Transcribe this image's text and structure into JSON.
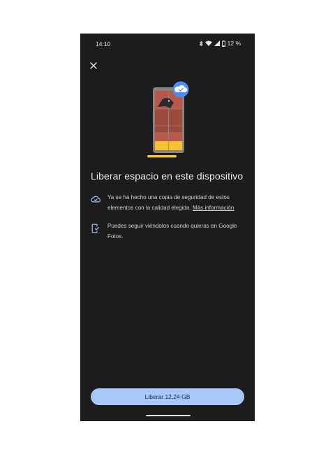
{
  "status_bar": {
    "time": "14:10",
    "battery_percent": "12 %",
    "icons": [
      "bluetooth-icon",
      "wifi-icon",
      "signal-icon",
      "battery-icon"
    ]
  },
  "close_icon": "close-icon",
  "title": "Liberar espacio en este dispositivo",
  "info_items": [
    {
      "icon": "cloud-done-icon",
      "text": "Ya se ha hecho una copia de seguridad de estos elementos con la calidad elegida.",
      "link": "Más información"
    },
    {
      "icon": "phone-check-icon",
      "text": "Puedes seguir viéndolos cuando quieras en Google Fotos."
    }
  ],
  "primary_button": {
    "label": "Liberar 12,24 GB"
  },
  "colors": {
    "background": "#1c1c1d",
    "accent": "#a8c7fa",
    "badge": "#4c8df6",
    "storage_bar": "#f6c033"
  }
}
